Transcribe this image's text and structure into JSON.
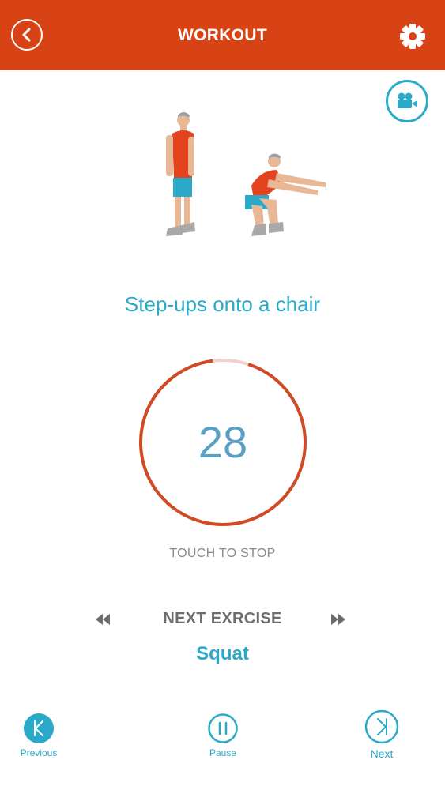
{
  "header": {
    "title": "WORKOUT",
    "back_icon": "back-arrow-icon",
    "settings_icon": "gear-icon",
    "color": "#d84315"
  },
  "video_button": {
    "icon": "video-camera-icon",
    "color": "#2aa9c9"
  },
  "exercise": {
    "name": "Step-ups onto a chair",
    "illustration": "squat-illustration"
  },
  "timer": {
    "value": "28",
    "progress": 0.93,
    "ring_color": "#d04a23",
    "remaining_color": "#f3d2ce"
  },
  "touch_to_stop": "TOUCH TO STOP",
  "next_exercise": {
    "label": "NEXT EXRCISE",
    "name": "Squat",
    "prev_icon": "rewind-icon",
    "next_icon": "fast-forward-icon"
  },
  "bottom_nav": {
    "previous": {
      "label": "Previous",
      "icon": "skip-previous-icon"
    },
    "pause": {
      "label": "Pause",
      "icon": "pause-icon"
    },
    "next": {
      "label": "Next",
      "icon": "skip-next-icon"
    }
  }
}
